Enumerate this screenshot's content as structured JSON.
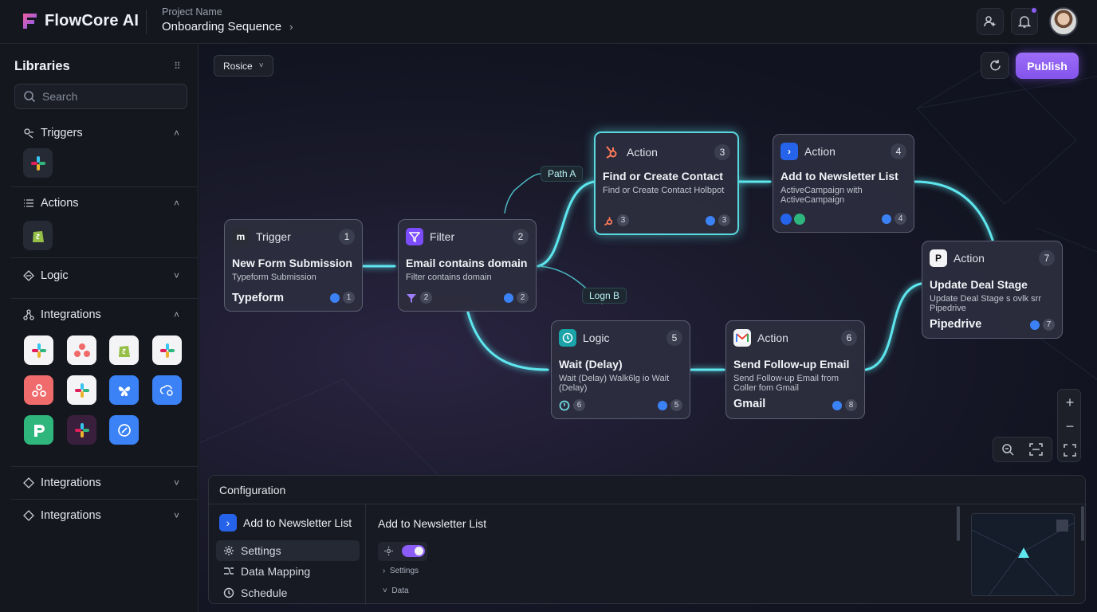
{
  "app": {
    "name": "FlowCore AI"
  },
  "project": {
    "label": "Project Name",
    "name": "Onboarding Sequence"
  },
  "sidebar": {
    "title": "Libraries",
    "search_placeholder": "Search",
    "sections": [
      {
        "label": "Triggers",
        "state": "expanded"
      },
      {
        "label": "Actions",
        "state": "expanded"
      },
      {
        "label": "Logic",
        "state": "collapsed"
      },
      {
        "label": "Integrations",
        "state": "expanded"
      },
      {
        "label": "Integrations",
        "state": "collapsed"
      },
      {
        "label": "Integrations",
        "state": "collapsed"
      }
    ]
  },
  "canvas": {
    "dropdown": "Rosice",
    "publish_label": "Publish",
    "path_labels": {
      "a": "Path A",
      "b": "Logn B"
    }
  },
  "nodes": [
    {
      "kind": "Trigger",
      "num": "1",
      "title": "New Form Submission",
      "sub": "Typeform Submission",
      "footer": "Typeform",
      "badge": "1"
    },
    {
      "kind": "Filter",
      "num": "2",
      "title": "Email contains domain",
      "sub": "Filter contains domain",
      "badge": "2"
    },
    {
      "kind": "Action",
      "num": "3",
      "title": "Find or Create Contact",
      "sub": "Find or Create Contact Holbpot",
      "badge": "3",
      "badge2": "3"
    },
    {
      "kind": "Action",
      "num": "4",
      "title": "Add to Newsletter List",
      "sub": "ActiveCampaign with ActiveCampaign",
      "badge": "4"
    },
    {
      "kind": "Logic",
      "num": "5",
      "title": "Wait (Delay)",
      "sub": "Wait (Delay) Walk6lg io Wait (Delay)",
      "badge": "5",
      "badge2": "6"
    },
    {
      "kind": "Action",
      "num": "6",
      "title": "Send Follow-up Email",
      "sub": "Send Follow-up Email from Coller fom Gmail",
      "footer": "Gmail",
      "badge": "8"
    },
    {
      "kind": "Action",
      "num": "7",
      "title": "Update Deal Stage",
      "sub": "Update Deal Stage s ovlk srr Pipedrive",
      "footer": "Pipedrive",
      "badge": "7"
    }
  ],
  "config": {
    "header": "Configuration",
    "selected_node": "Add to Newsletter List",
    "nav": [
      "Settings",
      "Data Mapping",
      "Schedule"
    ],
    "panel_title": "Add to Newsletter List",
    "tree": [
      "Settings",
      "Data"
    ],
    "toggle_on": true
  },
  "colors": {
    "accent": "#8b5cf6",
    "connector": "#5ee6ee",
    "bg": "#12141b"
  }
}
